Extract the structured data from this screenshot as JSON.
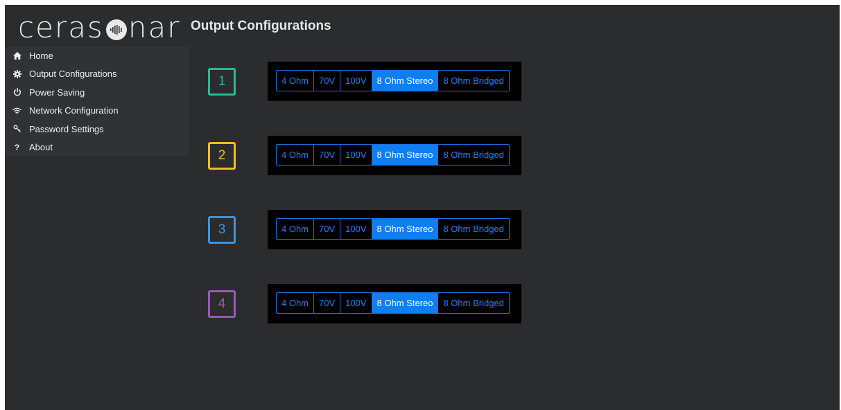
{
  "logo": {
    "left": "ceras",
    "right": "nar"
  },
  "page_title": "Output Configurations",
  "sidebar": {
    "items": [
      {
        "label": "Home",
        "icon": "home-icon"
      },
      {
        "label": "Output Configurations",
        "icon": "gear-icon"
      },
      {
        "label": "Power Saving",
        "icon": "power-icon"
      },
      {
        "label": "Network Configuration",
        "icon": "wifi-icon"
      },
      {
        "label": "Password Settings",
        "icon": "key-icon"
      },
      {
        "label": "About",
        "icon": "question-icon",
        "glyph": "?"
      }
    ]
  },
  "outputs": [
    {
      "channel": "1",
      "color": "#2bb89a",
      "modes": [
        "4 Ohm",
        "70V",
        "100V",
        "8 Ohm Stereo",
        "8 Ohm Bridged"
      ],
      "selected": "8 Ohm Stereo"
    },
    {
      "channel": "2",
      "color": "#f0c020",
      "modes": [
        "4 Ohm",
        "70V",
        "100V",
        "8 Ohm Stereo",
        "8 Ohm Bridged"
      ],
      "selected": "8 Ohm Stereo"
    },
    {
      "channel": "3",
      "color": "#3a96dd",
      "modes": [
        "4 Ohm",
        "70V",
        "100V",
        "8 Ohm Stereo",
        "8 Ohm Bridged"
      ],
      "selected": "8 Ohm Stereo"
    },
    {
      "channel": "4",
      "color": "#9b59b6",
      "modes": [
        "4 Ohm",
        "70V",
        "100V",
        "8 Ohm Stereo",
        "8 Ohm Bridged"
      ],
      "selected": "8 Ohm Stereo"
    }
  ],
  "colors": {
    "background": "#2b2c2e",
    "sidebar": "#303236",
    "accent": "#0f7ef0",
    "button_text": "#2b7df5"
  }
}
